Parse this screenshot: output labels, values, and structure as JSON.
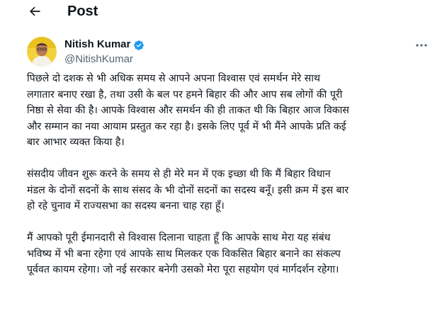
{
  "header": {
    "title": "Post",
    "back_icon": "arrow-left-icon"
  },
  "author": {
    "name": "Nitish Kumar",
    "handle": "@NitishKumar",
    "verified": true,
    "verified_color": "#1d9bf0",
    "more_icon": "more-horizontal-icon"
  },
  "tweet": {
    "paragraphs": [
      {
        "lines": [
          "पिछले दो दशक से भी अधिक समय से आपने अपना विश्वास एवं समर्थन मेरे साथ",
          "लगातार बनाए रखा है, तथा उसी के बल पर हमने बिहार की और आप सब लोगों की पूरी",
          "निष्ठा से सेवा की है। आपके विश्वास और समर्थन की ही ताकत थी कि बिहार आज विकास",
          "और सम्मान का नया आयाम प्रस्तुत कर रहा है। इसके लिए पूर्व में भी मैंने आपके प्रति कई",
          "बार आभार व्यक्त किया है।"
        ]
      },
      {
        "lines": [
          "संसदीय जीवन शुरू करने के समय से ही मेरे मन में एक इच्छा थी कि मैं बिहार विधान",
          "मंडल के दोनों सदनों के साथ संसद के भी दोनों सदनों का सदस्य बनूँ। इसी क्रम में इस बार",
          "हो रहे चुनाव में राज्यसभा का सदस्य बनना चाह रहा हूँ।"
        ]
      },
      {
        "lines": [
          "मैं आपको पूरी ईमानदारी से विश्वास दिलाना चाहता हूँ कि आपके साथ मेरा यह संबंध",
          "भविष्य में भी बना रहेगा एवं आपके साथ मिलकर एक विकसित बिहार बनाने का संकल्प",
          "पूर्ववत कायम रहेगा। जो नई सरकार बनेगी उसको मेरा पूरा सहयोग एवं मार्गदर्शन रहेगा।"
        ]
      }
    ]
  }
}
